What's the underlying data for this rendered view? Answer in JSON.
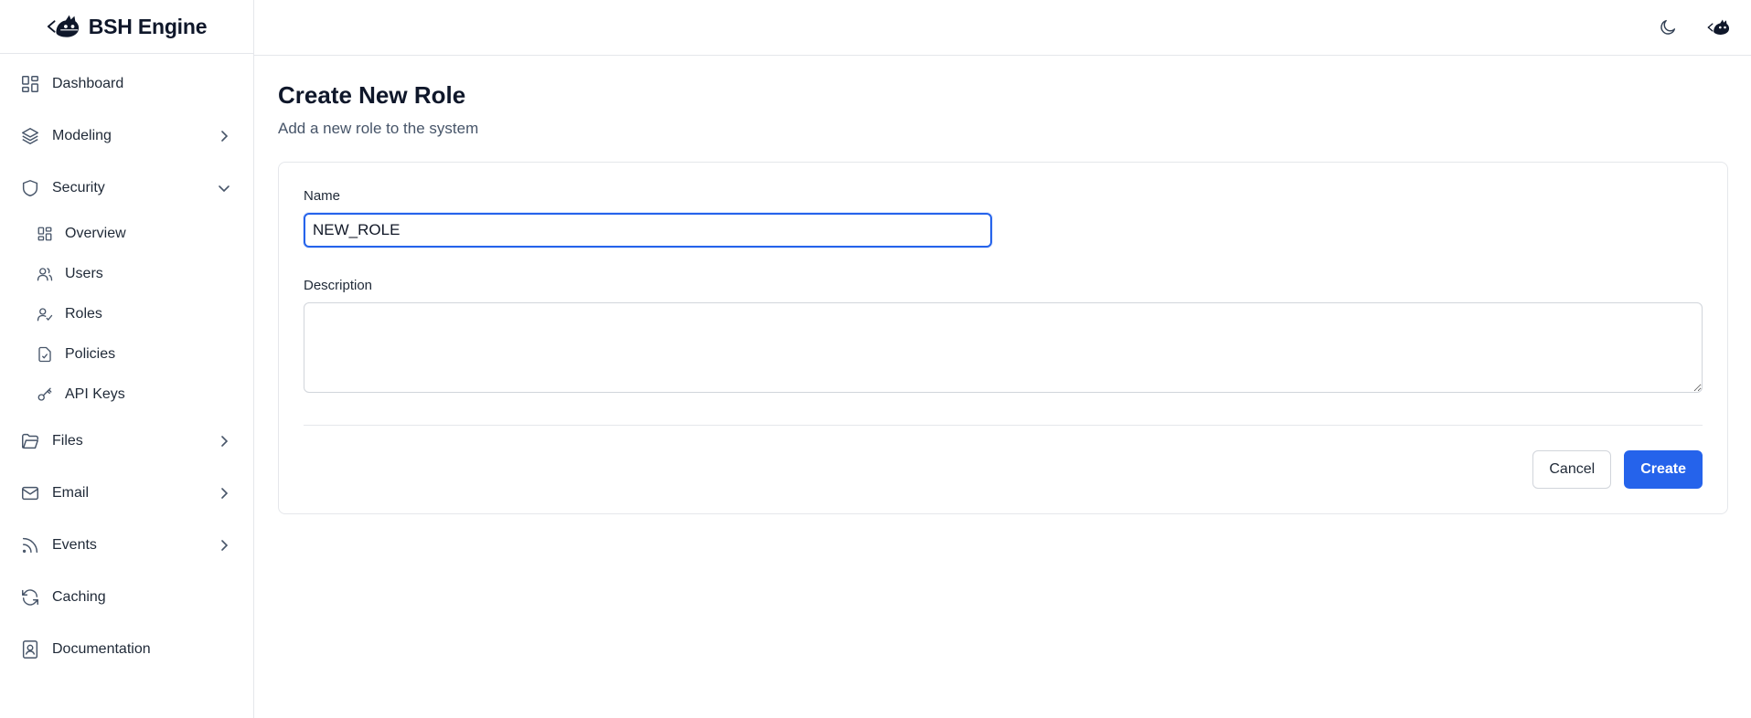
{
  "app": {
    "name": "BSH Engine"
  },
  "sidebar": {
    "items": [
      {
        "label": "Dashboard",
        "icon": "dashboard-icon"
      },
      {
        "label": "Modeling",
        "icon": "layers-icon",
        "expandable": true,
        "expanded": false
      },
      {
        "label": "Security",
        "icon": "shield-icon",
        "expandable": true,
        "expanded": true
      },
      {
        "label": "Files",
        "icon": "folder-icon",
        "expandable": true,
        "expanded": false
      },
      {
        "label": "Email",
        "icon": "mail-icon",
        "expandable": true,
        "expanded": false
      },
      {
        "label": "Events",
        "icon": "rss-icon",
        "expandable": true,
        "expanded": false
      },
      {
        "label": "Caching",
        "icon": "refresh-icon"
      },
      {
        "label": "Documentation",
        "icon": "book-icon"
      }
    ],
    "security_sub": [
      {
        "label": "Overview",
        "icon": "dashboard-icon"
      },
      {
        "label": "Users",
        "icon": "users-icon"
      },
      {
        "label": "Roles",
        "icon": "user-check-icon"
      },
      {
        "label": "Policies",
        "icon": "file-check-icon"
      },
      {
        "label": "API Keys",
        "icon": "key-icon"
      }
    ]
  },
  "header": {
    "theme_toggle_icon": "moon-icon",
    "avatar_icon": "raccoon-logo-icon"
  },
  "page": {
    "title": "Create New Role",
    "subtitle": "Add a new role to the system"
  },
  "form": {
    "name_label": "Name",
    "name_value": "NEW_ROLE",
    "description_label": "Description",
    "description_value": "",
    "cancel_label": "Cancel",
    "create_label": "Create"
  },
  "colors": {
    "accent": "#2563eb",
    "border": "#e5e7eb",
    "text": "#0f172a",
    "muted": "#475569"
  }
}
